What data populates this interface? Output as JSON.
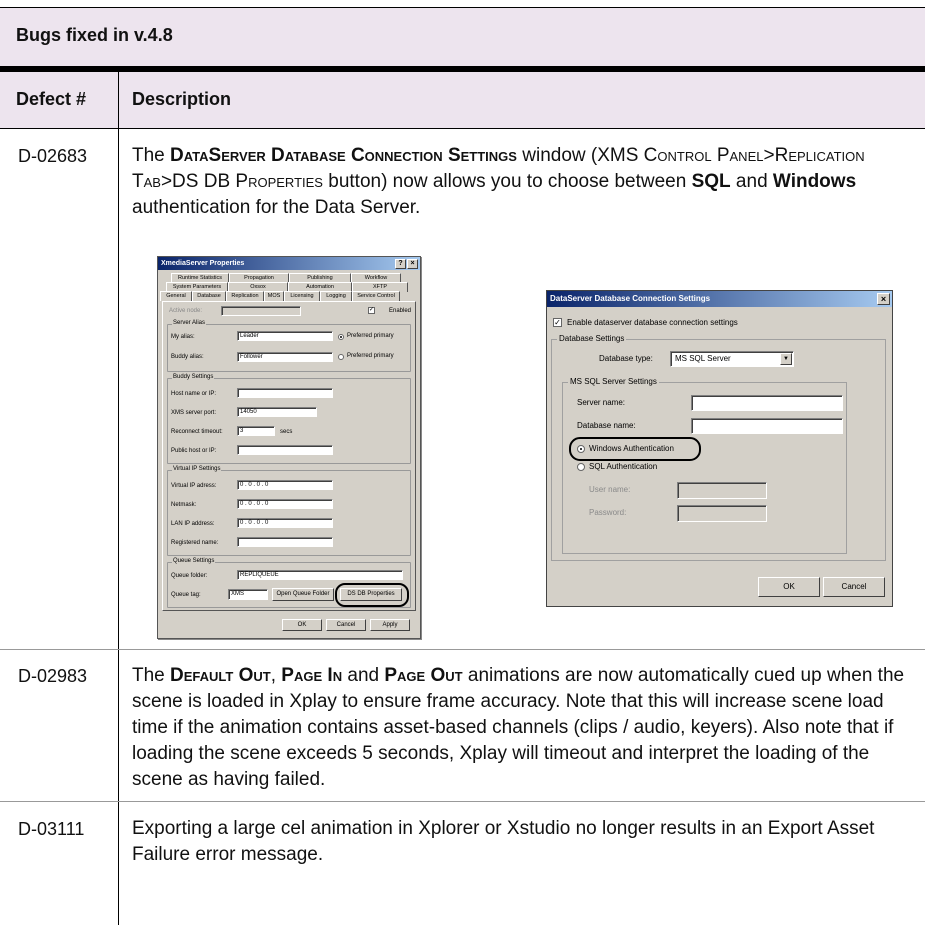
{
  "table": {
    "title": "Bugs fixed in v.4.8",
    "header": {
      "defect": "Defect #",
      "description": "Description"
    },
    "rows": [
      {
        "id": "D-02683",
        "p1": "The ",
        "b1": "DataServer Database Connection Settings",
        "p2": " window (XMS ",
        "sc1": "Control Panel",
        "p3": ">",
        "sc2": "Replication Tab",
        "p4": ">DS DB ",
        "sc3": "Properties",
        "p5": " button) now allows you to choose between ",
        "b2": "SQL",
        "p6": " and ",
        "b3": "Windows",
        "p7": " authentication for the Data Server."
      },
      {
        "id": "D-02983",
        "p1": "The ",
        "b1": "Default Out",
        "p2": ", ",
        "b2": "Page In",
        "p3": " and ",
        "b3": "Page Out",
        "p4": " animations are now automatically cued up when the scene is loaded in Xplay to ensure frame accuracy. Note that this will increase scene load time if the animation contains asset-based channels (clips / audio, keyers). Also note that if loading the scene exceeds 5 seconds, Xplay will timeout and interpret the loading of the scene as having failed."
      },
      {
        "id": "D-03111",
        "text": "Exporting a large cel animation in Xplorer or Xstudio no longer results in an Export Asset Failure error message."
      }
    ]
  },
  "props_window": {
    "title": "XmediaServer Properties",
    "title_buttons": [
      "?",
      "×"
    ],
    "tabs_row1": [
      "Runtime Statistics",
      "Propagation",
      "Publishing",
      "Workflow"
    ],
    "tabs_row2": [
      "System Parameters",
      "Oxsox",
      "Automation",
      "XFTP"
    ],
    "tabs_row3": [
      "General",
      "Database",
      "Replication",
      "MOS",
      "Licensing",
      "Logging",
      "Service Control"
    ],
    "active_tab": "Replication",
    "active_node_label": "Active node:",
    "enabled_label": "Enabled",
    "server_alias": {
      "group": "Server Alias",
      "my_alias_label": "My alias:",
      "my_alias": "Leader",
      "buddy_alias_label": "Buddy alias:",
      "buddy_alias": "Follower",
      "preferred_primary": "Preferred primary"
    },
    "buddy": {
      "group": "Buddy Settings",
      "host_label": "Host name or IP:",
      "port_label": "XMS server port:",
      "port": "14050",
      "timeout_label": "Reconnect timeout:",
      "timeout": "3",
      "secs": "secs",
      "public_label": "Public host or IP:"
    },
    "virtual_ip": {
      "group": "Virtual IP Settings",
      "vip_label": "Virtual IP adress:",
      "netmask_label": "Netmask:",
      "lan_label": "LAN IP address:",
      "ip_value": "0   .   0   .   0   .   0",
      "registered_label": "Registered name:"
    },
    "queue": {
      "group": "Queue Settings",
      "folder_label": "Queue folder:",
      "folder": "REPLIQUEUE",
      "tag_label": "Queue tag:",
      "tag": "XMS",
      "open_button": "Open Queue Folder",
      "dsdb_button": "DS DB Properties"
    },
    "buttons": {
      "ok": "OK",
      "cancel": "Cancel",
      "apply": "Apply"
    }
  },
  "ds_window": {
    "title": "DataServer Database Connection Settings",
    "close": "×",
    "enable_label": "Enable dataserver database connection settings",
    "db_group": "Database Settings",
    "db_type_label": "Database type:",
    "db_type": "MS SQL Server",
    "mssql_group": "MS SQL Server Settings",
    "server_label": "Server name:",
    "database_label": "Database name:",
    "windows_auth": "Windows Authentication",
    "sql_auth": "SQL Authentication",
    "user_label": "User name:",
    "password_label": "Password:",
    "ok": "OK",
    "cancel": "Cancel"
  }
}
